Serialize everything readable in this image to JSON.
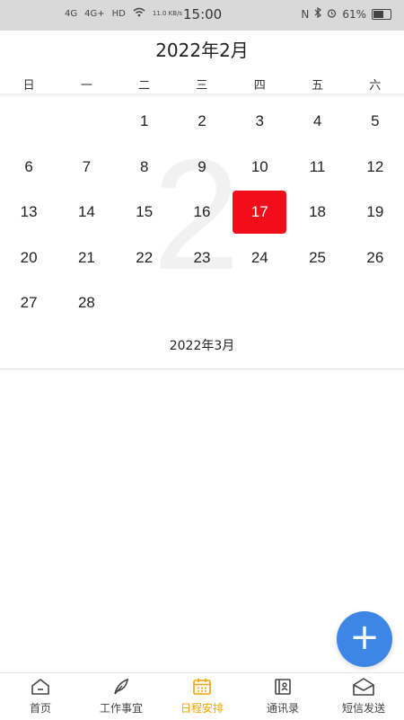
{
  "status_bar": {
    "signal_1": "4G",
    "signal_2": "4G+",
    "hd": "HD",
    "net_speed": "11.0 KB/s",
    "time": "15:00",
    "nfc": "N",
    "battery": "61%"
  },
  "calendar": {
    "month_title": "2022年2月",
    "weekdays": [
      "日",
      "一",
      "二",
      "三",
      "四",
      "五",
      "六"
    ],
    "watermark": "2",
    "days": [
      "1",
      "2",
      "3",
      "4",
      "5",
      "6",
      "7",
      "8",
      "9",
      "10",
      "11",
      "12",
      "13",
      "14",
      "15",
      "16",
      "17",
      "18",
      "19",
      "20",
      "21",
      "22",
      "23",
      "24",
      "25",
      "26",
      "27",
      "28"
    ],
    "first_weekday_index": 2,
    "selected_day": "17",
    "selected_color": "#f20d1a",
    "next_month_label": "2022年3月"
  },
  "fab": {
    "icon": "plus-icon",
    "color": "#3d86e6"
  },
  "tab_bar": {
    "active_color": "#f0a500",
    "items": [
      {
        "label": "首页",
        "icon": "home-icon"
      },
      {
        "label": "工作事宜",
        "icon": "feather-icon"
      },
      {
        "label": "日程安排",
        "icon": "calendar-icon"
      },
      {
        "label": "通讯录",
        "icon": "contacts-icon"
      },
      {
        "label": "短信发送",
        "icon": "envelope-icon"
      }
    ]
  }
}
